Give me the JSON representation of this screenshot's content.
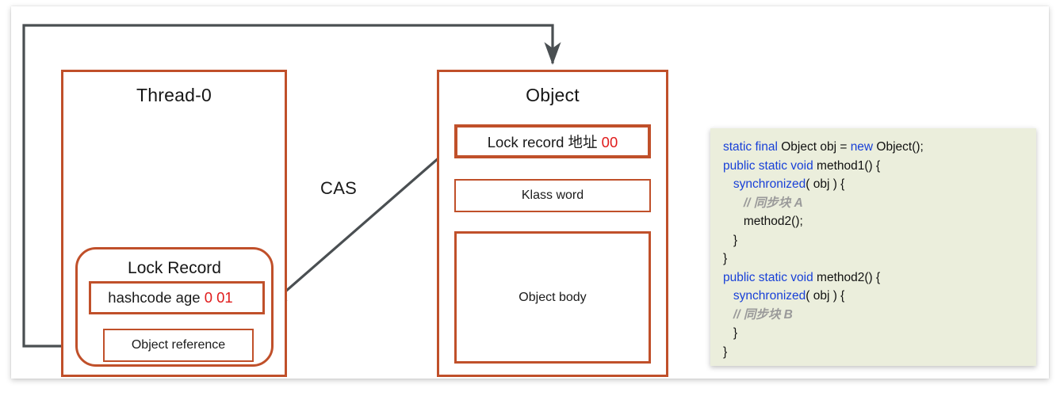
{
  "diagram": {
    "title_thread": "Thread-0",
    "title_object": "Object",
    "cas_label": "CAS",
    "thread": {
      "lock_record_title": "Lock Record",
      "hashcode_row": {
        "text": "hashcode age ",
        "bits": "0 01"
      },
      "object_reference_row": "Object reference"
    },
    "object": {
      "lock_record_row": {
        "text": "Lock record ",
        "address": "地址 ",
        "bits": "00"
      },
      "klass_word_row": "Klass word",
      "object_body_row": "Object body"
    },
    "colors": {
      "box_border": "#C0502A",
      "wire": "#4A4F52",
      "highlight_red": "#E01B1B",
      "code_background": "#EBEEDC",
      "code_keyword": "#1840D8",
      "code_comment": "#9A9A9A"
    }
  },
  "code": {
    "lines": [
      [
        {
          "t": "static final",
          "c": "kw"
        },
        {
          "t": " Object obj = ",
          "c": ""
        },
        {
          "t": "new",
          "c": "kw"
        },
        {
          "t": " Object();",
          "c": ""
        }
      ],
      [
        {
          "t": "public static void",
          "c": "kw"
        },
        {
          "t": " method1() {",
          "c": ""
        }
      ],
      [
        {
          "t": "   ",
          "c": ""
        },
        {
          "t": "synchronized",
          "c": "kw"
        },
        {
          "t": "( obj ) {",
          "c": ""
        }
      ],
      [
        {
          "t": "      ",
          "c": ""
        },
        {
          "t": "// 同步块 A",
          "c": "cm"
        }
      ],
      [
        {
          "t": "      method2();",
          "c": ""
        }
      ],
      [
        {
          "t": "   }",
          "c": ""
        }
      ],
      [
        {
          "t": "}",
          "c": ""
        }
      ],
      [
        {
          "t": "public static void",
          "c": "kw"
        },
        {
          "t": " method2() {",
          "c": ""
        }
      ],
      [
        {
          "t": "   ",
          "c": ""
        },
        {
          "t": "synchronized",
          "c": "kw"
        },
        {
          "t": "( obj ) {",
          "c": ""
        }
      ],
      [
        {
          "t": "   ",
          "c": ""
        },
        {
          "t": "// 同步块 B",
          "c": "cm"
        }
      ],
      [
        {
          "t": "   }",
          "c": ""
        }
      ],
      [
        {
          "t": "}",
          "c": ""
        }
      ]
    ]
  }
}
